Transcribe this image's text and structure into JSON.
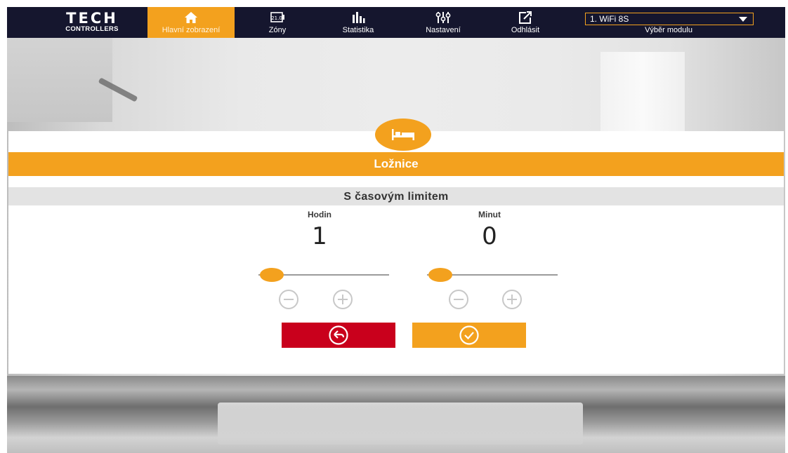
{
  "brand": {
    "name": "TECH",
    "subtitle": "CONTROLLERS"
  },
  "nav": {
    "items": [
      {
        "id": "home",
        "label": "Hlavní zobrazení",
        "icon": "home-icon",
        "active": true
      },
      {
        "id": "zones",
        "label": "Zóny",
        "icon": "zone-thermometer-icon",
        "active": false
      },
      {
        "id": "stats",
        "label": "Statistika",
        "icon": "bar-chart-icon",
        "active": false
      },
      {
        "id": "settings",
        "label": "Nastavení",
        "icon": "sliders-icon",
        "active": false
      },
      {
        "id": "logout",
        "label": "Odhlásit",
        "icon": "logout-icon",
        "active": false
      }
    ],
    "zone_icon_text": "21.0"
  },
  "module": {
    "selected": "1. WiFi 8S",
    "caption": "Výběr modulu"
  },
  "dialog": {
    "icon": "bed-icon",
    "zone_name": "Ložnice",
    "mode": "S časovým limitem",
    "hours": {
      "label": "Hodin",
      "value": "1",
      "slider_fraction": 0.1
    },
    "minutes": {
      "label": "Minut",
      "value": "0",
      "slider_fraction": 0.1
    },
    "back_icon": "back-arrow-icon",
    "confirm_icon": "check-icon"
  },
  "colors": {
    "accent": "#f3a11e",
    "navbar": "#15162e",
    "cancel": "#c9001c"
  }
}
